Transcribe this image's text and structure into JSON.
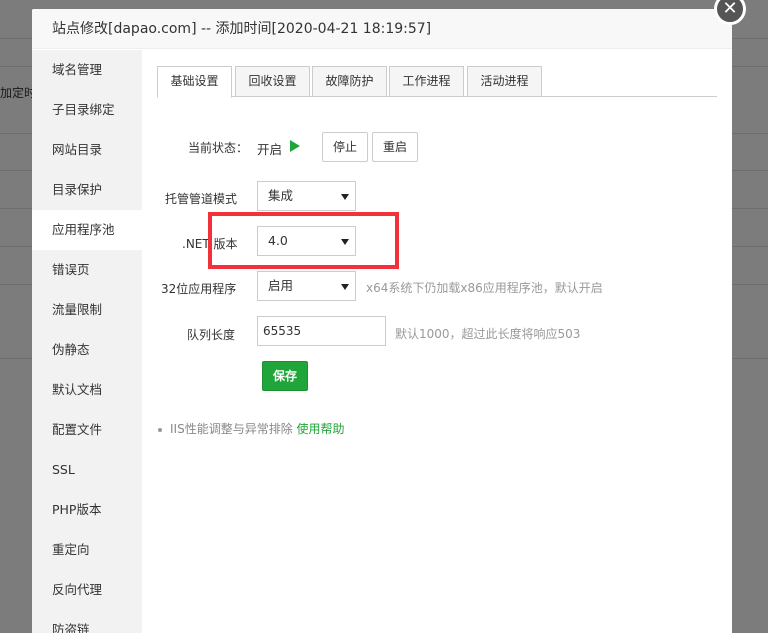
{
  "background": {
    "partial_text": "加定时"
  },
  "dialog": {
    "title": "站点修改[dapao.com] -- 添加时间[2020-04-21 18:19:57]",
    "close_glyph": "✕"
  },
  "sidebar": {
    "items": [
      {
        "label": "域名管理"
      },
      {
        "label": "子目录绑定"
      },
      {
        "label": "网站目录"
      },
      {
        "label": "目录保护"
      },
      {
        "label": "应用程序池"
      },
      {
        "label": "错误页"
      },
      {
        "label": "流量限制"
      },
      {
        "label": "伪静态"
      },
      {
        "label": "默认文档"
      },
      {
        "label": "配置文件"
      },
      {
        "label": "SSL"
      },
      {
        "label": "PHP版本"
      },
      {
        "label": "重定向"
      },
      {
        "label": "反向代理"
      },
      {
        "label": "防盗链"
      }
    ],
    "active_index": 4
  },
  "tabs": [
    {
      "label": "基础设置"
    },
    {
      "label": "回收设置"
    },
    {
      "label": "故障防护"
    },
    {
      "label": "工作进程"
    },
    {
      "label": "活动进程"
    }
  ],
  "form": {
    "status_label": "当前状态：",
    "status_value": "开启",
    "stop_button": "停止",
    "restart_button": "重启",
    "pipeline_label": "托管管道模式",
    "pipeline_value": "集成",
    "net_label": ".NET 版本",
    "net_value": "4.0",
    "bit32_label": "32位应用程序",
    "bit32_value": "启用",
    "bit32_hint": "x64系统下仍加载x86应用程序池，默认开启",
    "queue_label": "队列长度",
    "queue_value": "65535",
    "queue_hint": "默认1000，超过此长度将响应503",
    "save_button": "保存"
  },
  "help": {
    "text": "IIS性能调整与异常排除",
    "link": "使用帮助"
  },
  "colors": {
    "accent": "#20a53a",
    "highlight": "#f2313a"
  }
}
